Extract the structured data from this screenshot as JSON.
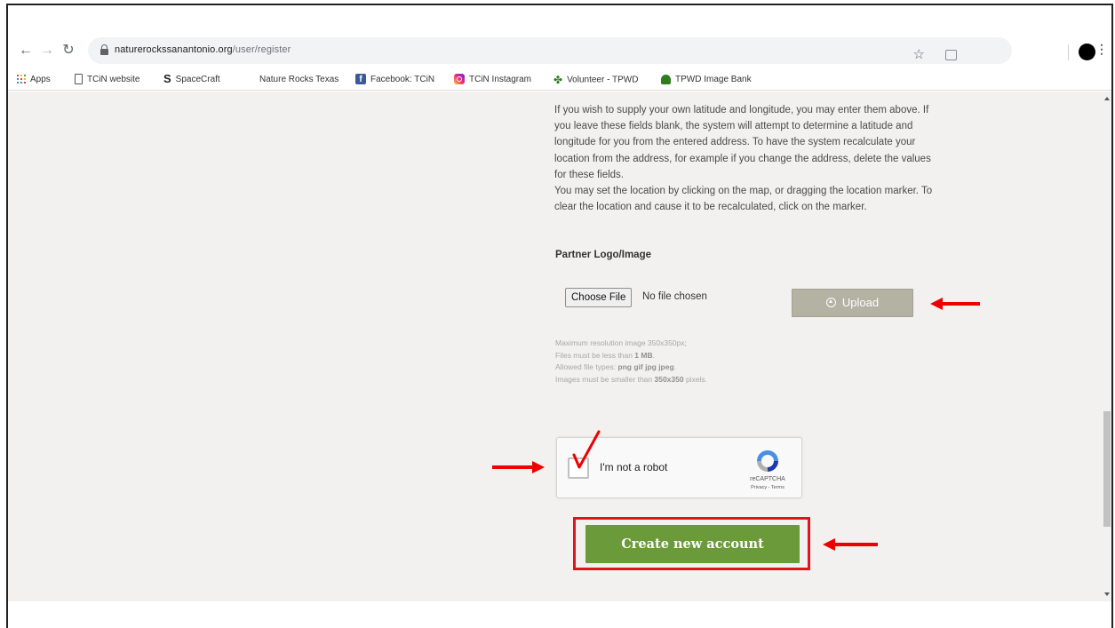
{
  "browser": {
    "url_host": "naturerockssanantonio.org",
    "url_path": "/user/register"
  },
  "bookmarks": [
    {
      "label": "Apps",
      "icon": "apps-grid-icon"
    },
    {
      "label": "TCiN website",
      "icon": "document-icon"
    },
    {
      "label": "SpaceCraft",
      "icon": "spacecraft-s-icon"
    },
    {
      "label": "Nature Rocks Texas",
      "icon": "none"
    },
    {
      "label": "Facebook: TCiN",
      "icon": "facebook-icon"
    },
    {
      "label": "TCiN Instagram",
      "icon": "instagram-icon"
    },
    {
      "label": "Volunteer - TPWD",
      "icon": "texas-icon"
    },
    {
      "label": "TPWD Image Bank",
      "icon": "tpwd-icon"
    }
  ],
  "location_help": [
    "If you wish to supply your own latitude and longitude, you may enter them above. If you leave these fields blank, the system will attempt to determine a latitude and longitude for you from the entered address. To have the system recalculate your location from the address, for example if you change the address, delete the values for these fields.",
    "You may set the location by clicking on the map, or dragging the location marker. To clear the location and cause it to be recalculated, click on the marker."
  ],
  "logo_field": {
    "label": "Partner Logo/Image",
    "choose_file_label": "Choose File",
    "file_status": "No file chosen",
    "upload_label": "Upload",
    "help": {
      "line1": "Maximum resolution image 350x350px;",
      "line2_prefix": "Files must be less than ",
      "line2_bold": "1 MB",
      "line2_suffix": ".",
      "line3_prefix": "Allowed file types: ",
      "line3_bold": "png gif jpg jpeg",
      "line3_suffix": ".",
      "line4_prefix": "Images must be smaller than ",
      "line4_bold": "350x350",
      "line4_suffix": " pixels."
    }
  },
  "recaptcha": {
    "label": "I'm not a robot",
    "brand": "reCAPTCHA",
    "terms": "Privacy - Terms",
    "checked": true
  },
  "submit": {
    "label": "Create new account"
  },
  "colors": {
    "page_bg": "#f2f1ef",
    "create_button": "#6b9a3b",
    "upload_button": "#b4b2a3",
    "annotation_red": "#e00000"
  }
}
